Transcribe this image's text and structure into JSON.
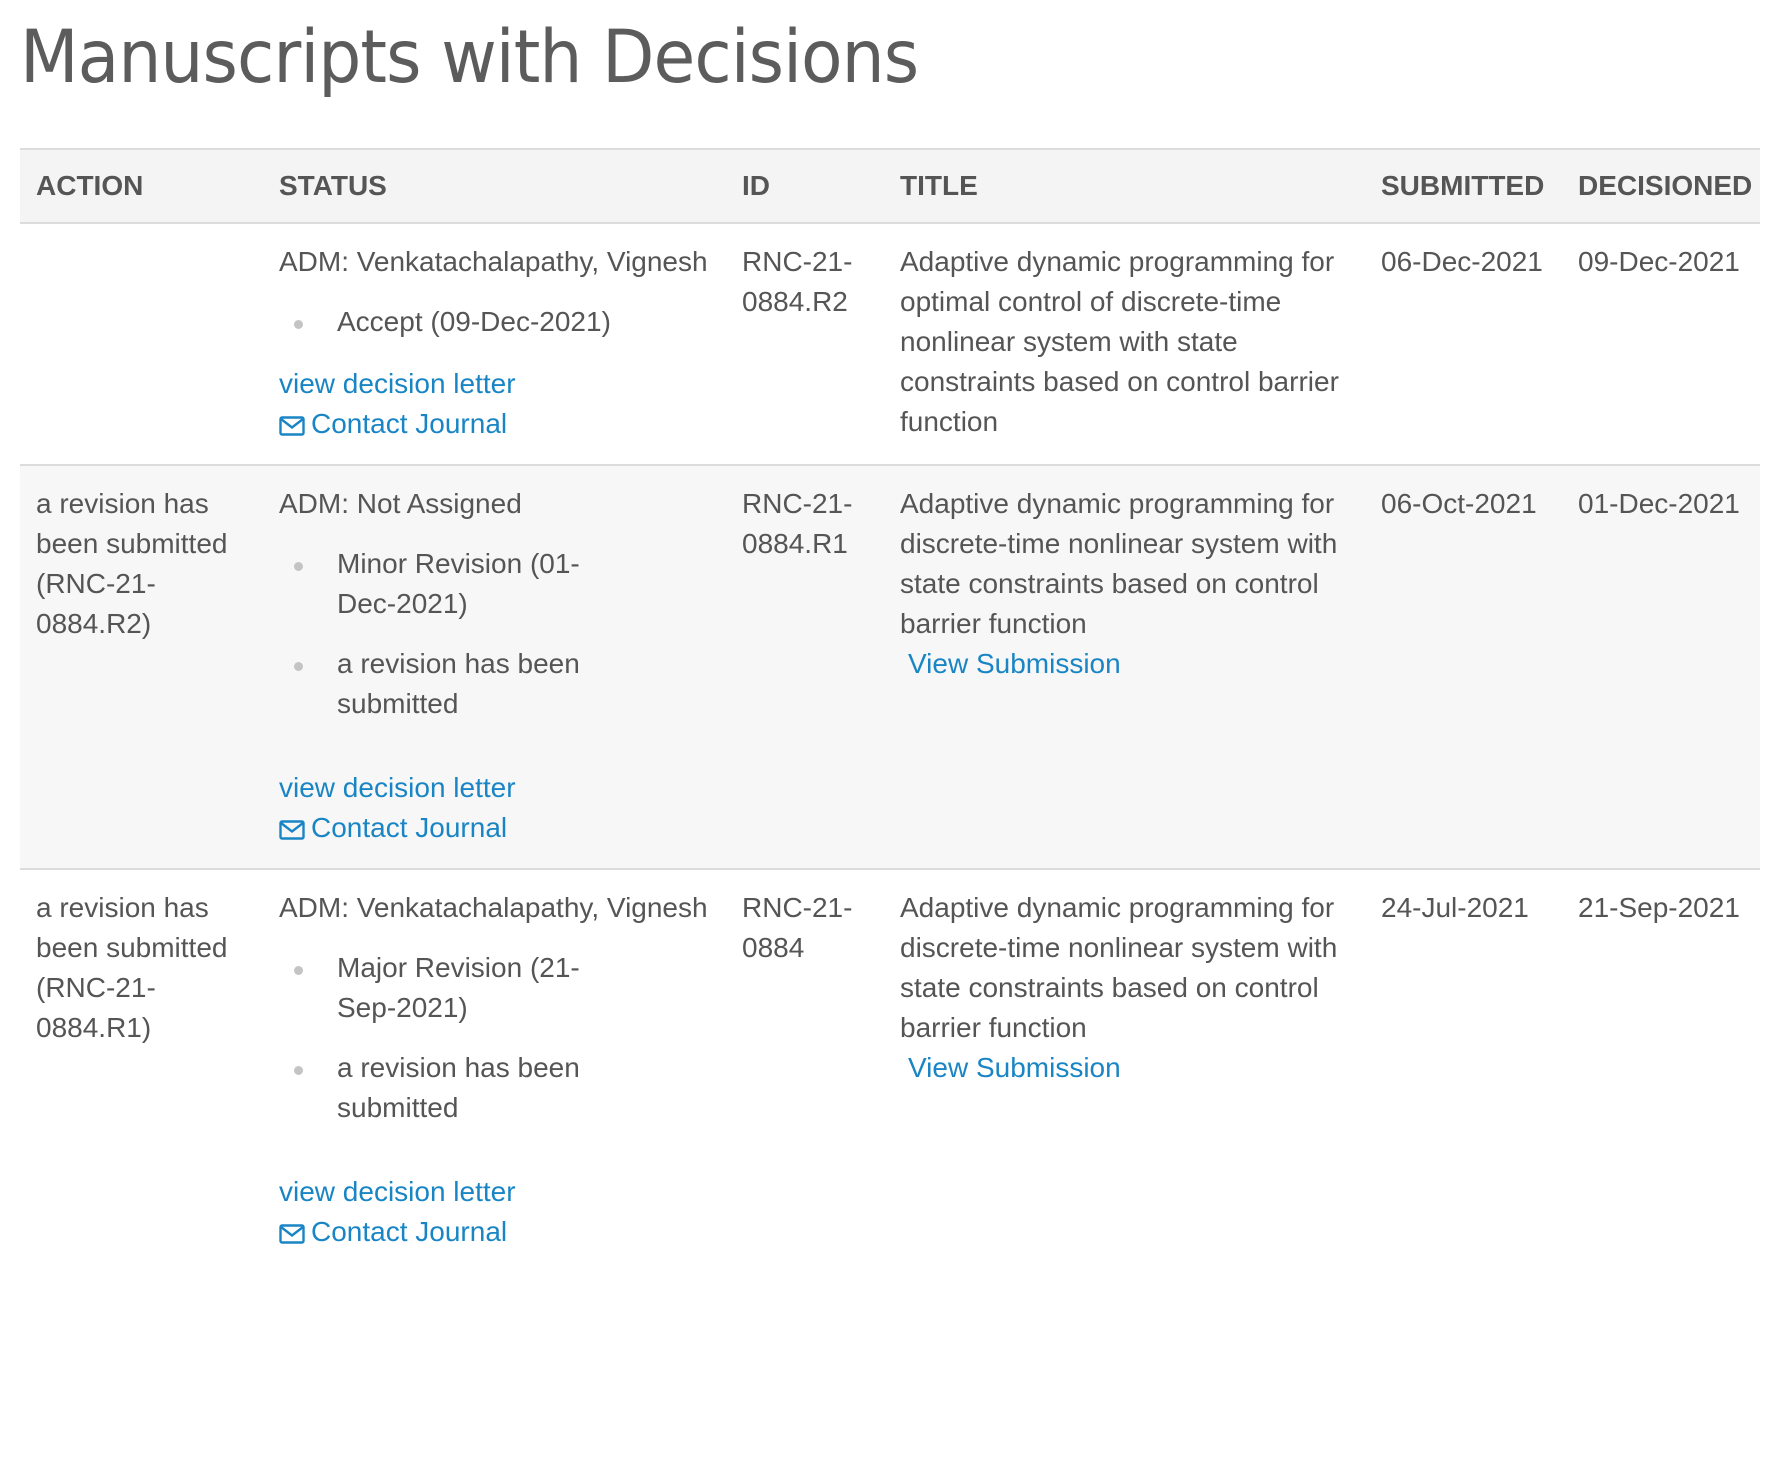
{
  "page": {
    "title": "Manuscripts with Decisions"
  },
  "table": {
    "headers": {
      "action": "ACTION",
      "status": "STATUS",
      "id": "ID",
      "title": "TITLE",
      "submitted": "SUBMITTED",
      "decisioned": "DECISIONED"
    },
    "rows": [
      {
        "action": "",
        "status_admin": "ADM: Venkatachalapathy, Vignesh",
        "status_items": [
          "Accept (09-Dec-2021)"
        ],
        "view_decision_letter": "view decision letter",
        "contact_journal": "Contact Journal",
        "id": "RNC-21-0884.R2",
        "title": "Adaptive dynamic programming for optimal control of discrete-time nonlinear system with state constraints based on control barrier function",
        "view_submission": "",
        "submitted": "06-Dec-2021",
        "decisioned": "09-Dec-2021"
      },
      {
        "action": "a revision has been submitted (RNC-21-0884.R2)",
        "status_admin": "ADM: Not Assigned",
        "status_items": [
          "Minor Revision (01-Dec-2021)",
          "a revision has been submitted"
        ],
        "view_decision_letter": "view decision letter",
        "contact_journal": "Contact Journal",
        "id": "RNC-21-0884.R1",
        "title": "Adaptive dynamic programming for discrete-time nonlinear system with state constraints based on control barrier function",
        "view_submission": "View Submission",
        "submitted": "06-Oct-2021",
        "decisioned": "01-Dec-2021"
      },
      {
        "action": "a revision has been submitted (RNC-21-0884.R1)",
        "status_admin": "ADM: Venkatachalapathy, Vignesh",
        "status_items": [
          "Major Revision (21-Sep-2021)",
          "a revision has been submitted"
        ],
        "view_decision_letter": "view decision letter",
        "contact_journal": "Contact Journal",
        "id": "RNC-21-0884",
        "title": "Adaptive dynamic programming for discrete-time nonlinear system with state constraints based on control barrier function",
        "view_submission": "View Submission",
        "submitted": "24-Jul-2021",
        "decisioned": "21-Sep-2021"
      }
    ]
  },
  "icons": {
    "bullet": "bullet-dot-icon",
    "contact": "envelope-icon"
  },
  "colors": {
    "link": "#1a85c4",
    "text": "#555555",
    "header_bg": "#f4f4f4",
    "alt_row_bg": "#f7f7f7",
    "border": "#dcdcdc"
  }
}
